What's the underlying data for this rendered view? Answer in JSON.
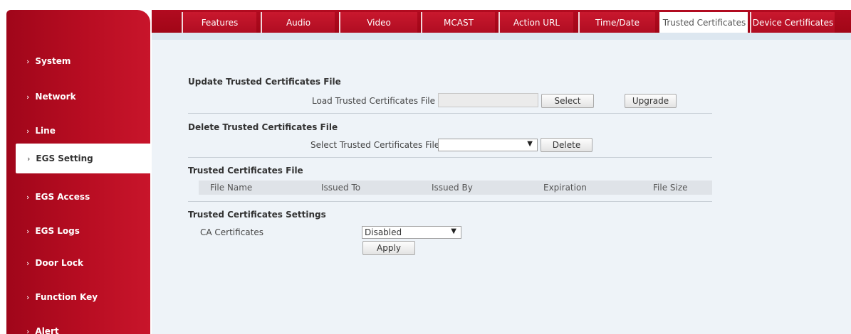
{
  "sidebar": {
    "items": [
      {
        "label": "System",
        "active": false
      },
      {
        "label": "Network",
        "active": false
      },
      {
        "label": "Line",
        "active": false
      },
      {
        "label": "EGS Setting",
        "active": true
      },
      {
        "label": "EGS Access",
        "active": false
      },
      {
        "label": "EGS Logs",
        "active": false
      },
      {
        "label": "Door Lock",
        "active": false
      },
      {
        "label": "Function Key",
        "active": false
      },
      {
        "label": "Alert",
        "active": false
      }
    ],
    "chevron": "›"
  },
  "tabs": [
    {
      "label": "Features"
    },
    {
      "label": "Audio"
    },
    {
      "label": "Video"
    },
    {
      "label": "MCAST"
    },
    {
      "label": "Action URL"
    },
    {
      "label": "Time/Date"
    },
    {
      "label": "Trusted Certificates",
      "active": true
    },
    {
      "label": "Device Certificates"
    }
  ],
  "update": {
    "title": "Update Trusted Certificates File",
    "load_label": "Load Trusted Certificates File",
    "file_value": "",
    "select_button": "Select",
    "upgrade_button": "Upgrade"
  },
  "delete": {
    "title": "Delete Trusted Certificates File",
    "select_label": "Select Trusted Certificates File",
    "selected_value": "",
    "delete_button": "Delete"
  },
  "file_table": {
    "title": "Trusted Certificates File",
    "columns": [
      "File Name",
      "Issued To",
      "Issued By",
      "Expiration",
      "File Size"
    ],
    "rows": []
  },
  "settings": {
    "title": "Trusted Certificates Settings",
    "ca_label": "CA Certificates",
    "ca_value": "Disabled",
    "apply_button": "Apply"
  },
  "colors": {
    "brand_red": "#b80d22",
    "content_bg": "#eef3f8"
  },
  "icons": {
    "dropdown": "▼"
  }
}
